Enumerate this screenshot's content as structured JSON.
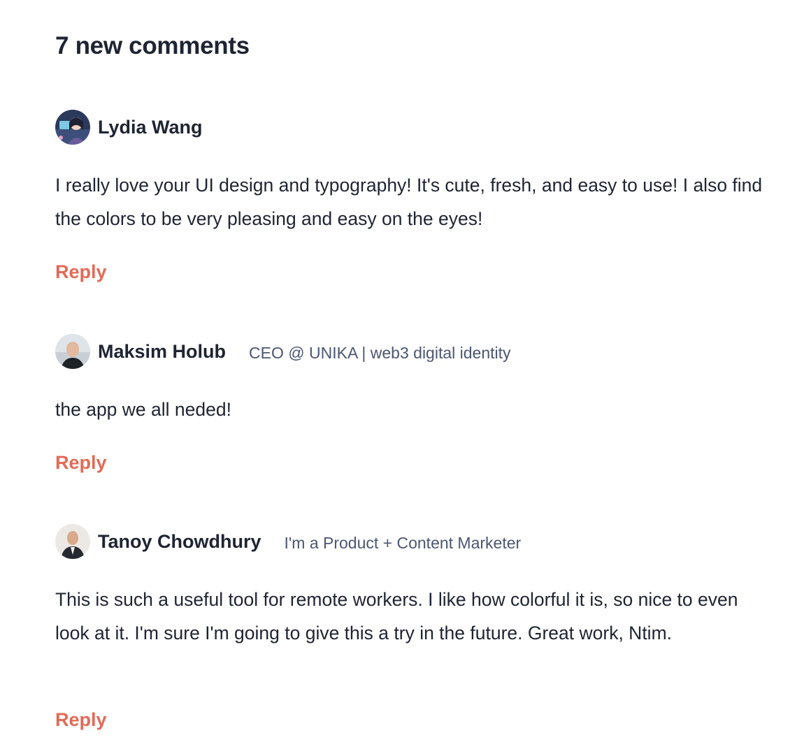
{
  "heading": "7 new comments",
  "colors": {
    "text": "#1f2433",
    "muted": "#4b5672",
    "accent": "#e26b57"
  },
  "comments": [
    {
      "author": "Lydia Wang",
      "headline": "",
      "avatar_icon": "avatar-illustration-icon",
      "body": "I really love your UI design and typography! It's cute, fresh, and easy to use! I also find the colors to be very pleasing and easy on the eyes!",
      "reply_label": "Reply"
    },
    {
      "author": "Maksim Holub",
      "headline": "CEO @ UNIKA | web3 digital identity",
      "avatar_icon": "avatar-photo-icon",
      "body": "the app we all neded!",
      "reply_label": "Reply"
    },
    {
      "author": "Tanoy Chowdhury",
      "headline": "I'm a Product + Content Marketer",
      "avatar_icon": "avatar-photo-icon",
      "body": "This is such a useful tool for remote workers. I like how colorful it is, so nice to even look at it. I'm sure I'm going to give this a try in the future. Great work, Ntim.",
      "reply_label": "Reply"
    }
  ]
}
